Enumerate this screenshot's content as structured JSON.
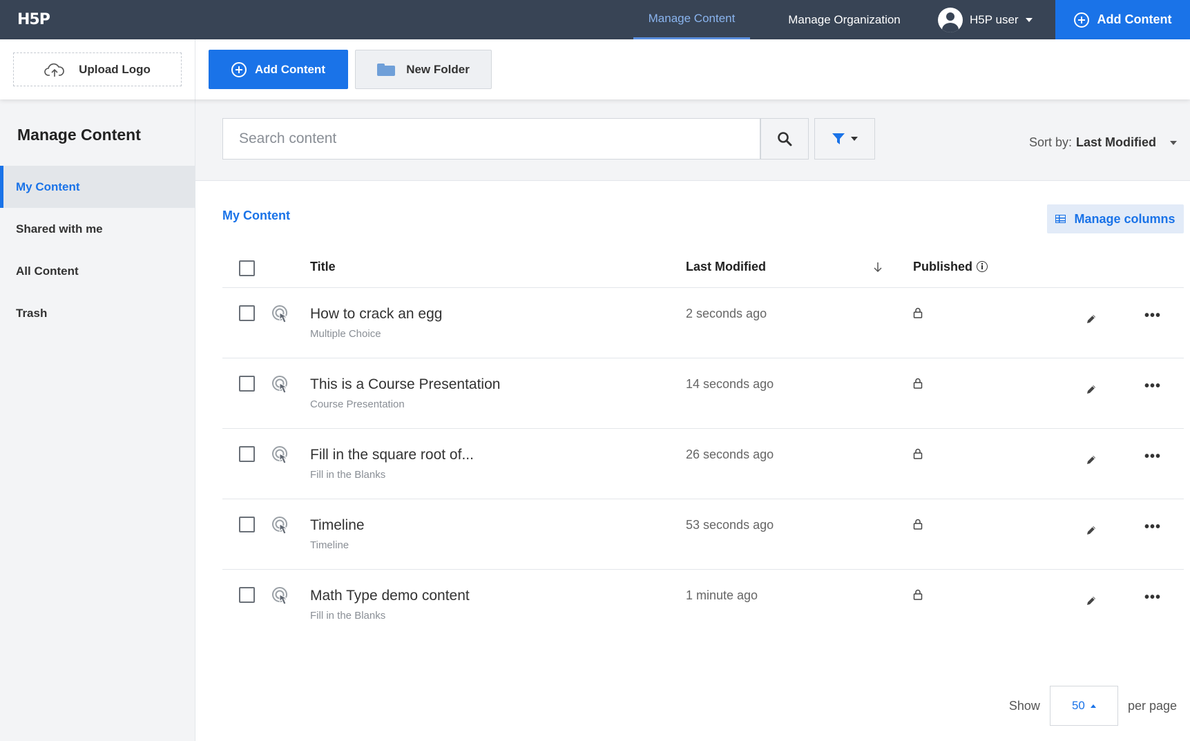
{
  "app": {
    "logo": "H5P"
  },
  "topnav": {
    "manage_content": "Manage Content",
    "manage_organization": "Manage Organization",
    "user_name": "H5P user",
    "add_content": "Add Content"
  },
  "toolbar": {
    "upload_logo": "Upload Logo",
    "add_content": "Add Content",
    "new_folder": "New Folder"
  },
  "sidebar": {
    "title": "Manage Content",
    "items": [
      {
        "label": "My Content",
        "active": true
      },
      {
        "label": "Shared with me",
        "active": false
      },
      {
        "label": "All Content",
        "active": false
      },
      {
        "label": "Trash",
        "active": false
      }
    ]
  },
  "search": {
    "placeholder": "Search content",
    "sort_label": "Sort by:",
    "sort_value": "Last Modified"
  },
  "content": {
    "breadcrumb": "My Content",
    "manage_columns": "Manage columns",
    "columns": {
      "title": "Title",
      "last_modified": "Last Modified",
      "published": "Published"
    },
    "rows": [
      {
        "title": "How to crack an egg",
        "type": "Multiple Choice",
        "modified": "2 seconds ago"
      },
      {
        "title": "This is a Course Presentation",
        "type": "Course Presentation",
        "modified": "14 seconds ago"
      },
      {
        "title": "Fill in the square root of...",
        "type": "Fill in the Blanks",
        "modified": "26 seconds ago"
      },
      {
        "title": "Timeline",
        "type": "Timeline",
        "modified": "53 seconds ago"
      },
      {
        "title": "Math Type demo content",
        "type": "Fill in the Blanks",
        "modified": "1 minute ago"
      }
    ]
  },
  "pagination": {
    "show_label": "Show",
    "per_page_value": "50",
    "per_page_label": "per page"
  },
  "colors": {
    "topbar": "#384455",
    "accent": "#1a73e8",
    "sidebar_bg": "#f3f4f6"
  }
}
